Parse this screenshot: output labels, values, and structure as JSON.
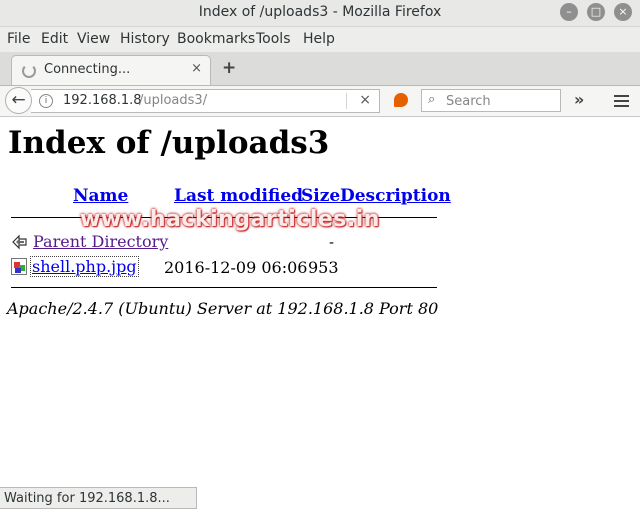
{
  "window": {
    "title": "Index of /uploads3 - Mozilla Firefox",
    "controls": [
      "minimize-icon",
      "maximize-icon",
      "close-icon"
    ]
  },
  "menu": {
    "items": [
      "File",
      "Edit",
      "View",
      "History",
      "Bookmarks",
      "Tools",
      "Help"
    ]
  },
  "tabs": [
    {
      "label": "Connecting...",
      "close": "×"
    }
  ],
  "new_tab": "+",
  "nav": {
    "url_host": "192.168.1.8",
    "url_path": "/uploads3/",
    "search_placeholder": "Search",
    "overflow": "»",
    "stop": "×"
  },
  "page": {
    "heading": "Index of /uploads3",
    "columns": [
      "Name",
      "Last modified",
      "Size",
      "Description"
    ],
    "parent": {
      "name": "Parent Directory",
      "size": "-"
    },
    "files": [
      {
        "name": "shell.php.jpg",
        "modified": "2016-12-09 06:06",
        "size": "953"
      }
    ],
    "address": "Apache/2.4.7 (Ubuntu) Server at 192.168.1.8 Port 80",
    "watermark": "www.hackingarticles.in"
  },
  "status": "Waiting for 192.168.1.8...",
  "colors": {
    "link": "#0000ee",
    "visited": "#551a8b",
    "watermark_outline": "#c62828",
    "firefox_accent": "#e66000"
  }
}
